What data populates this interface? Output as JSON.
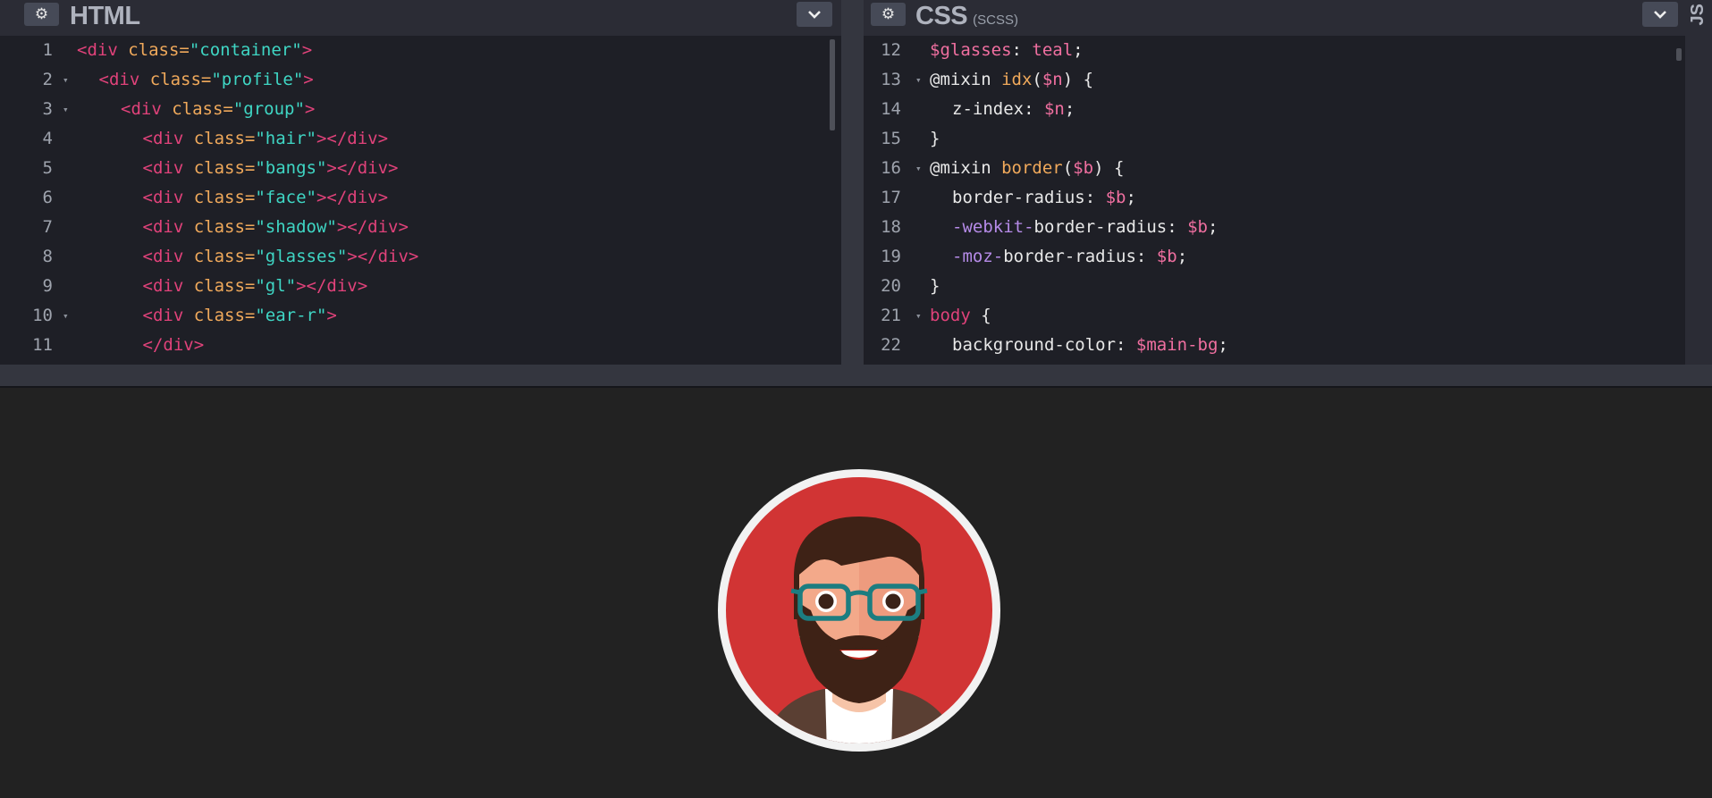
{
  "html_pane": {
    "title": "HTML",
    "settings_icon": "gear-icon",
    "collapse_icon": "chevron-down-icon",
    "lines": [
      {
        "num": "1",
        "indent": 0,
        "fold": false,
        "tokens": [
          [
            "tag",
            "<div "
          ],
          [
            "attr",
            "class="
          ],
          [
            "str",
            "\"container\""
          ],
          [
            "tag",
            ">"
          ]
        ]
      },
      {
        "num": "2",
        "indent": 1,
        "fold": true,
        "tokens": [
          [
            "tag",
            "<div "
          ],
          [
            "attr",
            "class="
          ],
          [
            "str",
            "\"profile\""
          ],
          [
            "tag",
            ">"
          ]
        ]
      },
      {
        "num": "3",
        "indent": 2,
        "fold": true,
        "tokens": [
          [
            "tag",
            "<div "
          ],
          [
            "attr",
            "class="
          ],
          [
            "str",
            "\"group\""
          ],
          [
            "tag",
            ">"
          ]
        ]
      },
      {
        "num": "4",
        "indent": 3,
        "fold": false,
        "tokens": [
          [
            "tag",
            "<div "
          ],
          [
            "attr",
            "class="
          ],
          [
            "str",
            "\"hair\""
          ],
          [
            "tag",
            "></div>"
          ]
        ]
      },
      {
        "num": "5",
        "indent": 3,
        "fold": false,
        "tokens": [
          [
            "tag",
            "<div "
          ],
          [
            "attr",
            "class="
          ],
          [
            "str",
            "\"bangs\""
          ],
          [
            "tag",
            "></div>"
          ]
        ]
      },
      {
        "num": "6",
        "indent": 3,
        "fold": false,
        "tokens": [
          [
            "tag",
            "<div "
          ],
          [
            "attr",
            "class="
          ],
          [
            "str",
            "\"face\""
          ],
          [
            "tag",
            "></div>"
          ]
        ]
      },
      {
        "num": "7",
        "indent": 3,
        "fold": false,
        "tokens": [
          [
            "tag",
            "<div "
          ],
          [
            "attr",
            "class="
          ],
          [
            "str",
            "\"shadow\""
          ],
          [
            "tag",
            "></div>"
          ]
        ]
      },
      {
        "num": "8",
        "indent": 3,
        "fold": false,
        "tokens": [
          [
            "tag",
            "<div "
          ],
          [
            "attr",
            "class="
          ],
          [
            "str",
            "\"glasses\""
          ],
          [
            "tag",
            "></div>"
          ]
        ]
      },
      {
        "num": "9",
        "indent": 3,
        "fold": false,
        "tokens": [
          [
            "tag",
            "<div "
          ],
          [
            "attr",
            "class="
          ],
          [
            "str",
            "\"gl\""
          ],
          [
            "tag",
            "></div>"
          ]
        ]
      },
      {
        "num": "10",
        "indent": 3,
        "fold": true,
        "tokens": [
          [
            "tag",
            "<div "
          ],
          [
            "attr",
            "class="
          ],
          [
            "str",
            "\"ear-r\""
          ],
          [
            "tag",
            ">"
          ]
        ]
      },
      {
        "num": "11",
        "indent": 3,
        "fold": false,
        "tokens": [
          [
            "tag",
            "</div>"
          ]
        ]
      }
    ]
  },
  "css_pane": {
    "title": "CSS",
    "subtitle": "(SCSS)",
    "settings_icon": "gear-icon",
    "collapse_icon": "chevron-down-icon",
    "lines": [
      {
        "num": "12",
        "indent": 0,
        "fold": false,
        "tokens": [
          [
            "var",
            "$glasses"
          ],
          [
            "plain",
            ": "
          ],
          [
            "var",
            "teal"
          ],
          [
            "plain",
            ";"
          ]
        ]
      },
      {
        "num": "13",
        "indent": 0,
        "fold": true,
        "tokens": [
          [
            "plain",
            "@mixin "
          ],
          [
            "fn",
            "idx"
          ],
          [
            "plain",
            "("
          ],
          [
            "var",
            "$n"
          ],
          [
            "plain",
            ") {"
          ]
        ]
      },
      {
        "num": "14",
        "indent": 1,
        "fold": false,
        "tokens": [
          [
            "plain",
            "z-index: "
          ],
          [
            "var",
            "$n"
          ],
          [
            "plain",
            ";"
          ]
        ]
      },
      {
        "num": "15",
        "indent": 0,
        "fold": false,
        "tokens": [
          [
            "plain",
            "}"
          ]
        ]
      },
      {
        "num": "16",
        "indent": 0,
        "fold": true,
        "tokens": [
          [
            "plain",
            "@mixin "
          ],
          [
            "fn",
            "border"
          ],
          [
            "plain",
            "("
          ],
          [
            "var",
            "$b"
          ],
          [
            "plain",
            ") {"
          ]
        ]
      },
      {
        "num": "17",
        "indent": 1,
        "fold": false,
        "tokens": [
          [
            "plain",
            "border-radius: "
          ],
          [
            "var",
            "$b"
          ],
          [
            "plain",
            ";"
          ]
        ]
      },
      {
        "num": "18",
        "indent": 1,
        "fold": false,
        "tokens": [
          [
            "vendor",
            "-webkit-"
          ],
          [
            "plain",
            "border-radius: "
          ],
          [
            "var",
            "$b"
          ],
          [
            "plain",
            ";"
          ]
        ]
      },
      {
        "num": "19",
        "indent": 1,
        "fold": false,
        "tokens": [
          [
            "vendor",
            "-moz-"
          ],
          [
            "plain",
            "border-radius: "
          ],
          [
            "var",
            "$b"
          ],
          [
            "plain",
            ";"
          ]
        ]
      },
      {
        "num": "20",
        "indent": 0,
        "fold": false,
        "tokens": [
          [
            "plain",
            "}"
          ]
        ]
      },
      {
        "num": "21",
        "indent": 0,
        "fold": true,
        "tokens": [
          [
            "kw",
            "body"
          ],
          [
            "plain",
            " {"
          ]
        ]
      },
      {
        "num": "22",
        "indent": 1,
        "fold": false,
        "tokens": [
          [
            "plain",
            "background-color: "
          ],
          [
            "var",
            "$main-bg"
          ],
          [
            "plain",
            ";"
          ]
        ]
      }
    ]
  },
  "js_pane": {
    "title": "JS"
  },
  "preview": {
    "avatar_colors": {
      "ring": "#f2f2f2",
      "background": "#d13434",
      "hair": "#3e2216",
      "skin": "#f3a98a",
      "glasses": "#1c7d80",
      "jacket": "#5a3f33"
    }
  }
}
